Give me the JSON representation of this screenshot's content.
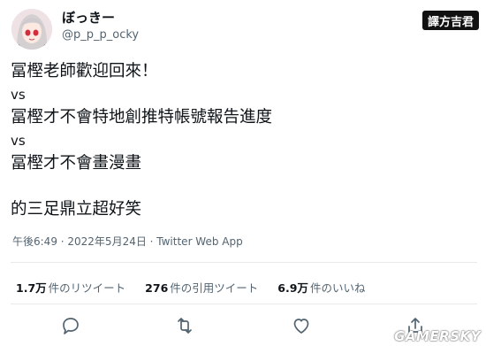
{
  "author": {
    "display_name": "ぼっきー",
    "handle": "@p_p_p_ocky"
  },
  "watermark": {
    "text": "譯方吉君"
  },
  "tweet": {
    "lines": [
      "冨樫老師歡迎回來！",
      "vs",
      "冨樫才不會特地創推特帳號報告進度",
      "vs",
      "冨樫才不會畫漫畫",
      "",
      "的三足鼎立超好笑"
    ],
    "timestamp": "午後6:49 · 2022年5月24日 · Twitter Web App"
  },
  "stats": [
    {
      "count": "1.7万",
      "label": "件のリツイート"
    },
    {
      "count": "276",
      "label": "件の引用ツイート"
    },
    {
      "count": "6.9万",
      "label": "件のいいね"
    }
  ],
  "actions": {
    "icons": [
      "reply-icon",
      "retweet-icon",
      "like-icon",
      "share-icon"
    ]
  },
  "site_watermark": "GAMERSKY",
  "colors": {
    "text": "#0f1419",
    "secondary": "#536471",
    "divider": "#e7e9ea",
    "icon": "#536471"
  }
}
